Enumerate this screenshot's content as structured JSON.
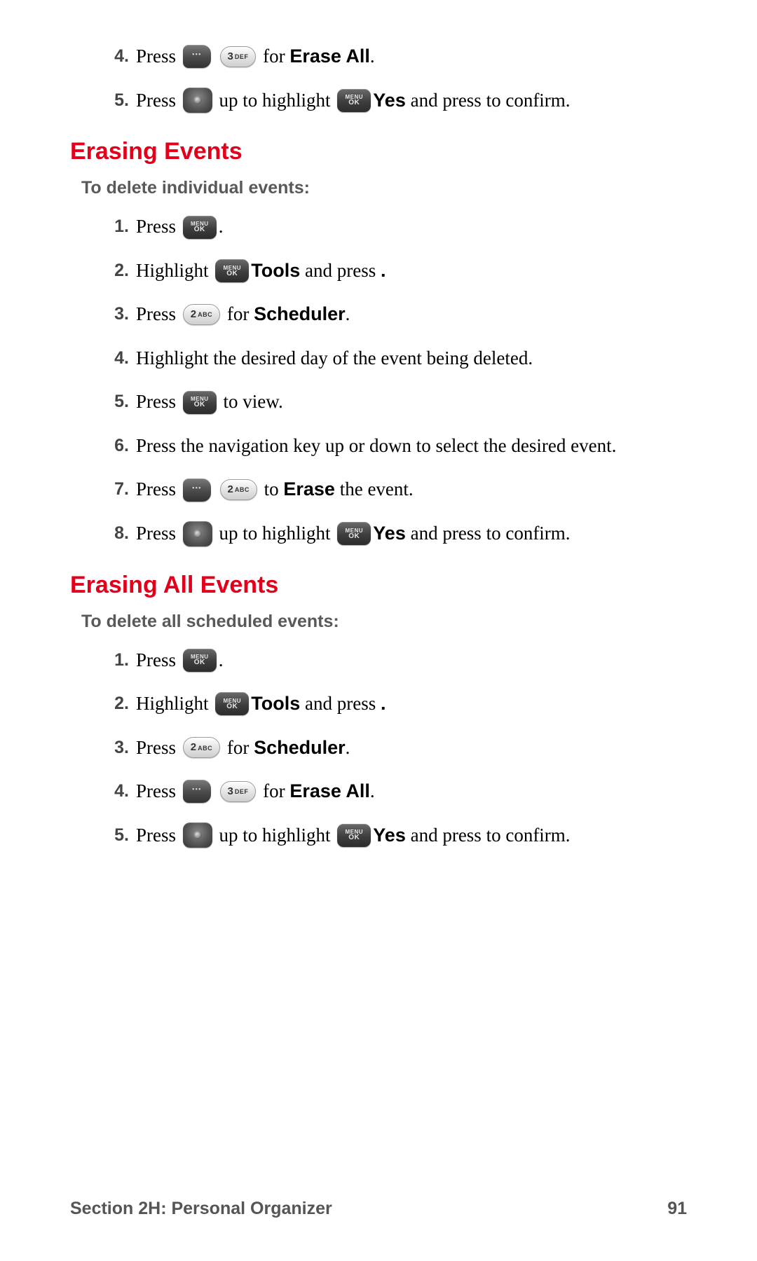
{
  "topSteps": [
    {
      "n": "4.",
      "parts": [
        "Press ",
        " ",
        " for ",
        {
          "b": "Erase All"
        },
        "."
      ],
      "icons": [
        "soft",
        "pill-3def"
      ]
    },
    {
      "n": "5.",
      "parts": [
        "Press ",
        " up to highlight ",
        {
          "b": "Yes"
        },
        " and press ",
        " to confirm."
      ],
      "icons": [
        "nav",
        "menuok"
      ]
    }
  ],
  "section1": {
    "title": "Erasing Events",
    "lead": "To delete individual events:",
    "steps": [
      {
        "n": "1.",
        "parts": [
          "Press ",
          "."
        ],
        "icons": [
          "menuok"
        ]
      },
      {
        "n": "2.",
        "parts": [
          "Highlight ",
          {
            "b": "Tools"
          },
          " and press ",
          {
            "b": "."
          }
        ],
        "icons": [
          "menuok"
        ],
        "iconBefore": 3
      },
      {
        "n": "3.",
        "parts": [
          "Press ",
          " for ",
          {
            "b": "Scheduler"
          },
          "."
        ],
        "icons": [
          "pill-2abc"
        ]
      },
      {
        "n": "4.",
        "parts": [
          "Highlight the desired day of the event being deleted."
        ],
        "icons": []
      },
      {
        "n": "5.",
        "parts": [
          "Press ",
          " to view."
        ],
        "icons": [
          "menuok"
        ]
      },
      {
        "n": "6.",
        "parts": [
          "Press the navigation key up or down to select the desired event."
        ],
        "icons": []
      },
      {
        "n": "7.",
        "parts": [
          "Press ",
          " ",
          " to ",
          {
            "b": "Erase"
          },
          " the event."
        ],
        "icons": [
          "soft",
          "pill-2abc"
        ]
      },
      {
        "n": "8.",
        "parts": [
          "Press ",
          " up to highlight ",
          {
            "b": "Yes"
          },
          " and press ",
          " to confirm."
        ],
        "icons": [
          "nav",
          "menuok"
        ]
      }
    ]
  },
  "section2": {
    "title": "Erasing All Events",
    "lead": "To delete all scheduled events:",
    "steps": [
      {
        "n": "1.",
        "parts": [
          "Press ",
          "."
        ],
        "icons": [
          "menuok"
        ]
      },
      {
        "n": "2.",
        "parts": [
          "Highlight ",
          {
            "b": "Tools"
          },
          " and press ",
          {
            "b": "."
          }
        ],
        "icons": [
          "menuok"
        ],
        "iconBefore": 3
      },
      {
        "n": "3.",
        "parts": [
          "Press ",
          " for ",
          {
            "b": "Scheduler"
          },
          "."
        ],
        "icons": [
          "pill-2abc"
        ]
      },
      {
        "n": "4.",
        "parts": [
          "Press ",
          " ",
          " for ",
          {
            "b": "Erase All"
          },
          "."
        ],
        "icons": [
          "soft",
          "pill-3def"
        ]
      },
      {
        "n": "5.",
        "parts": [
          "Press ",
          " up to highlight ",
          {
            "b": "Yes"
          },
          " and press ",
          " to confirm."
        ],
        "icons": [
          "nav",
          "menuok"
        ]
      }
    ]
  },
  "footer": {
    "left": "Section 2H: Personal Organizer",
    "right": "91"
  },
  "keys": {
    "menuok": {
      "l1": "MENU",
      "l2": "OK"
    },
    "pill-2abc": {
      "big": "2",
      "sub": "ABC"
    },
    "pill-3def": {
      "big": "3",
      "sub": "DEF"
    }
  }
}
